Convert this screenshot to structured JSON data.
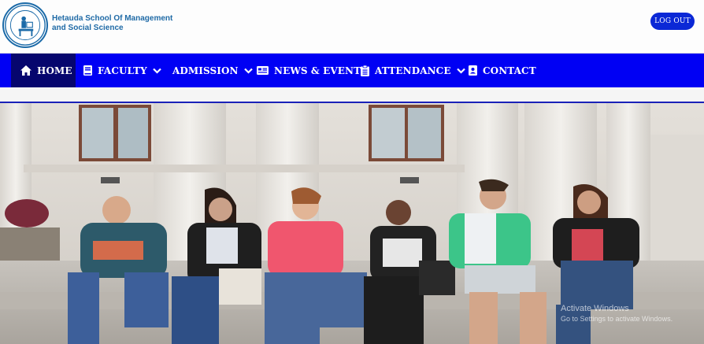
{
  "header": {
    "school_name_line1": "Hetauda School Of Management",
    "school_name_line2": "and Social Science",
    "logout_label": "LOG OUT"
  },
  "nav": {
    "items": [
      {
        "label": "HOME",
        "icon": "home-icon",
        "dropdown": false,
        "active": true
      },
      {
        "label": "FACULTY",
        "icon": "book-icon",
        "dropdown": true,
        "active": false
      },
      {
        "label": "ADMISSION",
        "icon": "",
        "dropdown": true,
        "active": false
      },
      {
        "label": "NEWS & EVENT",
        "icon": "newspaper-icon",
        "dropdown": false,
        "active": false
      },
      {
        "label": "ATTENDANCE",
        "icon": "clipboard-icon",
        "dropdown": true,
        "active": false
      },
      {
        "label": "CONTACT",
        "icon": "contact-card-icon",
        "dropdown": false,
        "active": false
      }
    ]
  },
  "watermark": {
    "line1": "Activate Windows",
    "line2": "Go to Settings to activate Windows."
  },
  "colors": {
    "nav_bg": "#0000f4",
    "nav_active_bg": "#06066e",
    "logout_bg": "#0b28d6",
    "brand_text": "#1f6aa6"
  }
}
